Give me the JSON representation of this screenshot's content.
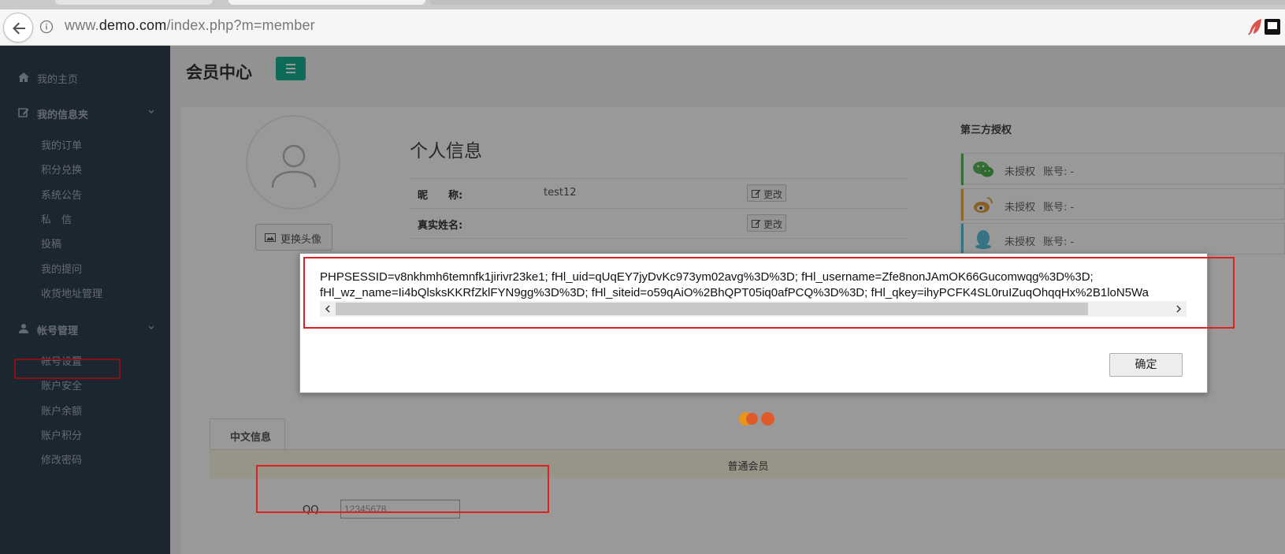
{
  "browser": {
    "url_prefix": "www.",
    "url_domain": "demo.com",
    "url_path": "/index.php?m=member"
  },
  "sidebar": {
    "home": {
      "label": "我的主页",
      "icon": "home-icon"
    },
    "info_folder": {
      "label": "我的信息夹",
      "icon": "edit-icon",
      "items": [
        "我的订单",
        "积分兑换",
        "系统公告",
        "私　信",
        "投稿",
        "我的提问",
        "收货地址管理"
      ]
    },
    "account_mgmt": {
      "label": "帐号管理",
      "icon": "user-icon",
      "items": [
        "帐号设置",
        "账户安全",
        "账户余额",
        "账户积分",
        "修改密码"
      ]
    }
  },
  "header": {
    "title": "会员中心",
    "menu_icon": "hamburger-icon"
  },
  "profile": {
    "avatar_button": "更换头像",
    "section_title": "个人信息",
    "fields": [
      {
        "label": "昵　　称:",
        "value": "test12",
        "edit": "更改"
      },
      {
        "label": "真实姓名:",
        "value": "",
        "edit": "更改"
      }
    ]
  },
  "auth": {
    "title": "第三方授权",
    "items": [
      {
        "service": "wechat",
        "icon": "wechat-icon",
        "status": "未授权",
        "account": "账号: -",
        "color": "#5cb85c"
      },
      {
        "service": "weibo",
        "icon": "weibo-icon",
        "status": "未授权",
        "account": "账号: -",
        "color": "#f0ad4e"
      },
      {
        "service": "qq",
        "icon": "qq-icon",
        "status": "未授权",
        "account": "账号: -",
        "color": "#5bc0de"
      }
    ]
  },
  "tabs": {
    "active": "中文信息"
  },
  "member_level": "普通会员",
  "qq": {
    "label": "QQ",
    "value": "12345678"
  },
  "dialog": {
    "line1": "PHPSESSID=v8nkhmh6temnfk1jirivr23ke1; fHl_uid=qUqEY7jyDvKc973ym02avg%3D%3D; fHl_username=Zfe8nonJAmOK66Gucomwqg%3D%3D;",
    "line2": "fHl_wz_name=Ii4bQlsksKKRfZklFYN9gg%3D%3D; fHl_siteid=o59qAiO%2BhQPT05iq0afPCQ%3D%3D; fHl_qkey=ihyPCFK4SL0ruIZuqOhqqHx%2B1loN5Wa",
    "ok_button": "确定"
  },
  "colors": {
    "sidebar_bg": "#2f4050",
    "accent": "#1ab394",
    "highlight": "#e02020"
  }
}
